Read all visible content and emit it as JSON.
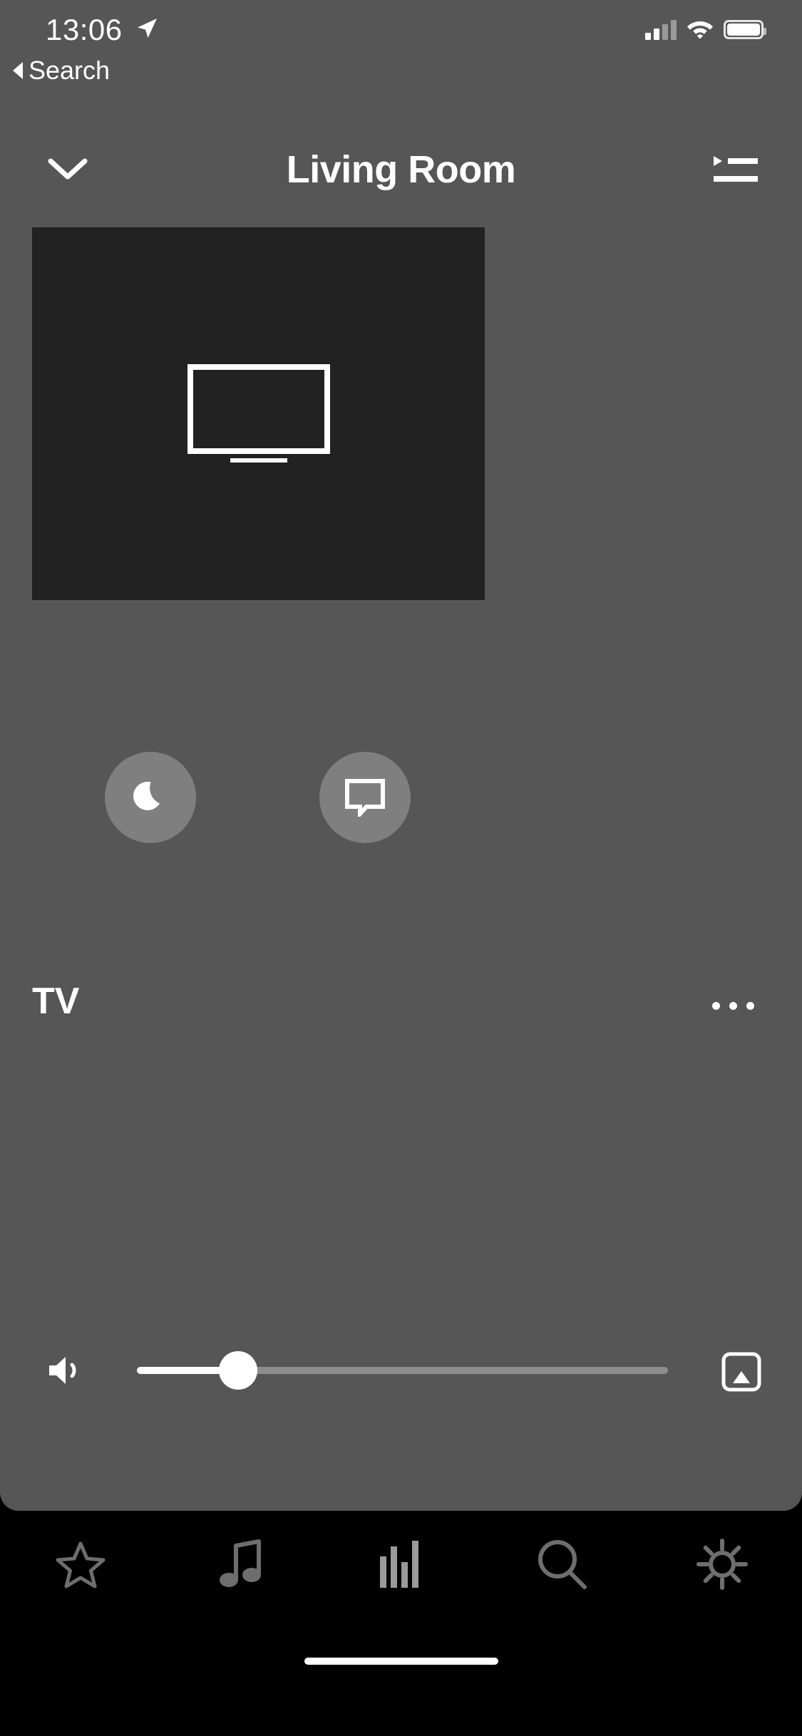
{
  "status_bar": {
    "time": "13:06",
    "location_icon": "location-arrow-icon",
    "signal_icon": "cellular-signal-icon",
    "signal_bars_filled": 2,
    "signal_bars_total": 4,
    "wifi_icon": "wifi-icon",
    "battery_icon": "battery-icon",
    "battery_level_pct": 100
  },
  "back_link": {
    "label": "Search",
    "icon": "back-caret-icon"
  },
  "header": {
    "title": "Living Room",
    "left_icon": "chevron-down-icon",
    "right_icon": "queue-list-icon"
  },
  "artwork": {
    "icon": "tv-icon",
    "background_color": "#222222"
  },
  "now_playing": {
    "title": "TV",
    "more_icon": "ellipsis-icon"
  },
  "feature_buttons": [
    {
      "name": "night-mode",
      "icon": "moon-icon",
      "circle_color": "#7f7f7f"
    },
    {
      "name": "speech-enhancement",
      "icon": "speech-bubble-icon",
      "circle_color": "#7f7f7f"
    }
  ],
  "volume": {
    "speaker_icon": "speaker-wave-icon",
    "airplay_icon": "airplay-icon",
    "level_pct": 19,
    "track_color": "#8d8d8d",
    "fill_color": "#ffffff"
  },
  "tab_bar": {
    "active_index": 2,
    "tabs": [
      {
        "icon": "star-icon",
        "name": "favorites"
      },
      {
        "icon": "music-note-icon",
        "name": "browse"
      },
      {
        "icon": "equalizer-icon",
        "name": "rooms"
      },
      {
        "icon": "search-icon",
        "name": "search"
      },
      {
        "icon": "gear-icon",
        "name": "settings"
      }
    ]
  },
  "theme": {
    "panel_background": "#565656",
    "tabbar_background": "#000000",
    "icon_inactive": "#6e6e6e",
    "icon_active": "#9a9a9a"
  }
}
